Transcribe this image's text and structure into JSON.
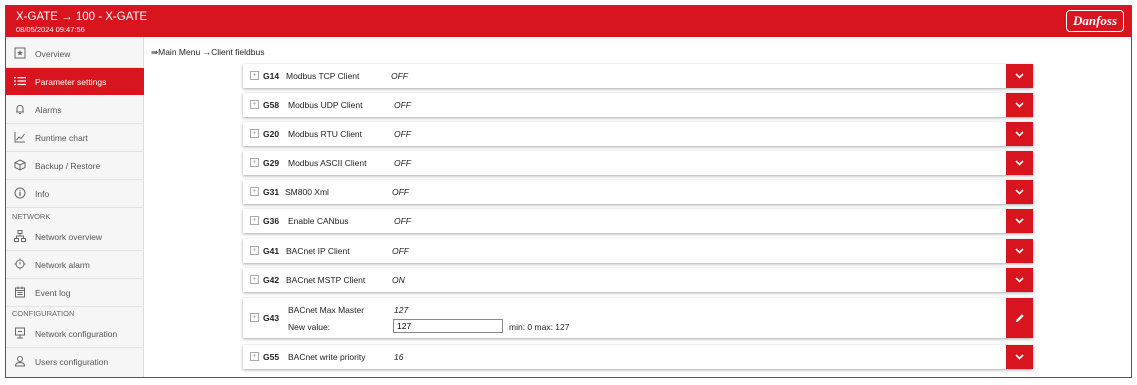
{
  "header": {
    "title": "X-GATE → 100 - X-GATE",
    "datetime": "08/05/2024 09:47:56",
    "logo_text": "Danfoss"
  },
  "sidebar": {
    "items": [
      {
        "label": "Overview",
        "icon": "star-box-icon"
      },
      {
        "label": "Parameter settings",
        "icon": "list-icon",
        "active": true
      },
      {
        "label": "Alarms",
        "icon": "bell-icon"
      },
      {
        "label": "Runtime chart",
        "icon": "line-chart-icon"
      },
      {
        "label": "Backup / Restore",
        "icon": "box-icon"
      },
      {
        "label": "Info",
        "icon": "info-icon"
      },
      {
        "label": "Network overview",
        "icon": "network-icon"
      },
      {
        "label": "Network alarm",
        "icon": "network-alarm-icon"
      },
      {
        "label": "Event log",
        "icon": "calendar-icon"
      },
      {
        "label": "Network configuration",
        "icon": "monitor-icon"
      },
      {
        "label": "Users configuration",
        "icon": "user-icon"
      }
    ],
    "sections": {
      "network": "NETWORK",
      "configuration": "CONFIGURATION"
    }
  },
  "breadcrumb": {
    "arrow_start": "⇛",
    "main_menu": "Main Menu",
    "arrow": "→",
    "current": "Client fieldbus"
  },
  "params": [
    {
      "code": "G14",
      "name": "Modbus TCP Client",
      "value": "OFF"
    },
    {
      "code": "G58",
      "name": "Modbus UDP Client",
      "value": "OFF"
    },
    {
      "code": "G20",
      "name": "Modbus RTU Client",
      "value": "OFF"
    },
    {
      "code": "G29",
      "name": "Modbus ASCII Client",
      "value": "OFF"
    },
    {
      "code": "G31",
      "name": "SM800 Xml",
      "value": "OFF"
    },
    {
      "code": "G36",
      "name": "Enable CANbus",
      "value": "OFF"
    },
    {
      "code": "G41",
      "name": "BACnet IP Client",
      "value": "OFF"
    },
    {
      "code": "G42",
      "name": "BACnet MSTP Client",
      "value": "ON"
    },
    {
      "code": "G43",
      "name": "BACnet Max Master",
      "value": "127",
      "new_value_label": "New value:",
      "new_value": "127",
      "range": "min: 0 max: 127"
    },
    {
      "code": "G55",
      "name": "BACnet write priority",
      "value": "16"
    }
  ],
  "colors": {
    "brand": "#d8141e"
  }
}
